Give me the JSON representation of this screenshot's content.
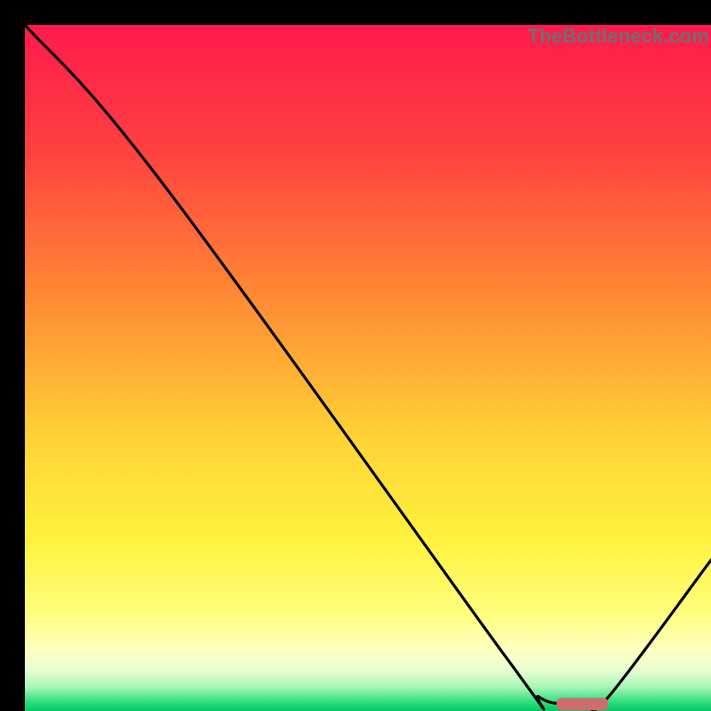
{
  "watermark": "TheBottleneck.com",
  "chart_data": {
    "type": "line",
    "title": "",
    "xlabel": "",
    "ylabel": "",
    "xlim": [
      0,
      100
    ],
    "ylim": [
      0,
      100
    ],
    "series": [
      {
        "name": "bottleneck-curve",
        "x": [
          0,
          20,
          70,
          75,
          80,
          82,
          85,
          100
        ],
        "values": [
          100,
          77,
          8,
          2,
          1,
          1,
          2,
          22
        ]
      }
    ],
    "marker": {
      "name": "optimal-range",
      "x_start": 77.5,
      "x_end": 85,
      "y": 1,
      "color": "#cc6e6e"
    },
    "gradient_stops": [
      {
        "pos": 0.0,
        "color": "#ff1a4d"
      },
      {
        "pos": 0.18,
        "color": "#ff4040"
      },
      {
        "pos": 0.4,
        "color": "#ff8b34"
      },
      {
        "pos": 0.6,
        "color": "#ffd236"
      },
      {
        "pos": 0.75,
        "color": "#fff23d"
      },
      {
        "pos": 0.86,
        "color": "#ffff80"
      },
      {
        "pos": 0.91,
        "color": "#ffffc0"
      },
      {
        "pos": 0.94,
        "color": "#e8ffd0"
      },
      {
        "pos": 0.965,
        "color": "#a8f5b8"
      },
      {
        "pos": 0.985,
        "color": "#38e080"
      },
      {
        "pos": 1.0,
        "color": "#00c864"
      }
    ]
  }
}
